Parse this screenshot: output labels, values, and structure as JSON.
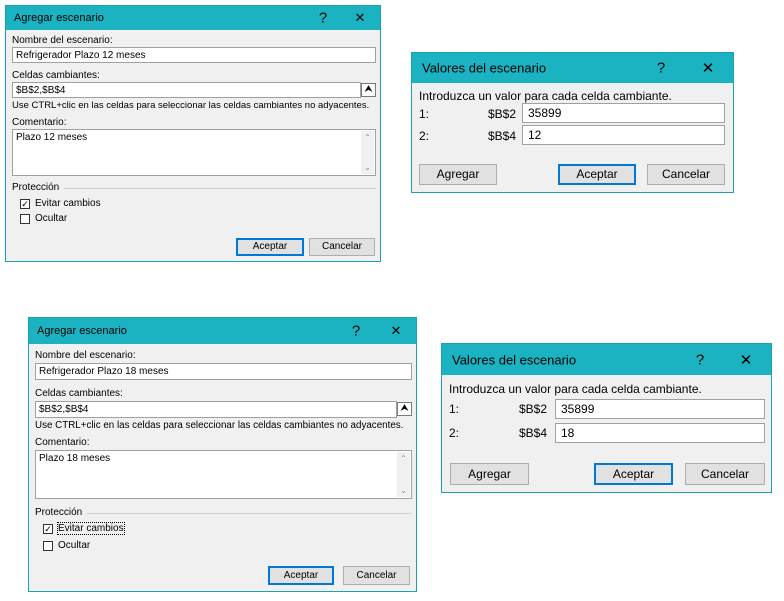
{
  "dialog1": {
    "title": "Agregar escenario",
    "help": "?",
    "close": "✕",
    "name_label": "Nombre del escenario:",
    "name_value": "Refrigerador Plazo 12 meses",
    "cells_label": "Celdas cambiantes:",
    "cells_value": "$B$2,$B$4",
    "hint": "Use CTRL+clic en las celdas para seleccionar las celdas cambiantes no adyacentes.",
    "comment_label": "Comentario:",
    "comment_value": "Plazo 12 meses",
    "protection_label": "Protección",
    "prevent_changes": "Evitar cambios",
    "prevent_checked": true,
    "hide": "Ocultar",
    "hide_checked": false,
    "ok": "Aceptar",
    "cancel": "Cancelar"
  },
  "values1": {
    "title": "Valores del escenario",
    "help": "?",
    "close": "✕",
    "prompt": "Introduzca un valor para cada celda cambiante.",
    "rows": [
      {
        "index": "1:",
        "ref": "$B$2",
        "value": "35899"
      },
      {
        "index": "2:",
        "ref": "$B$4",
        "value": "12"
      }
    ],
    "add": "Agregar",
    "ok": "Aceptar",
    "cancel": "Cancelar"
  },
  "dialog2": {
    "title": "Agregar escenario",
    "help": "?",
    "close": "✕",
    "name_label": "Nombre del escenario:",
    "name_value": "Refrigerador Plazo 18 meses",
    "cells_label": "Celdas cambiantes:",
    "cells_value": "$B$2,$B$4",
    "hint": "Use CTRL+clic en las celdas para seleccionar las celdas cambiantes no adyacentes.",
    "comment_label": "Comentario:",
    "comment_value": "Plazo 18 meses",
    "protection_label": "Protección",
    "prevent_changes": "Evitar cambios",
    "prevent_checked": true,
    "hide": "Ocultar",
    "hide_checked": false,
    "ok": "Aceptar",
    "cancel": "Cancelar"
  },
  "values2": {
    "title": "Valores del escenario",
    "help": "?",
    "close": "✕",
    "prompt": "Introduzca un valor para cada celda cambiante.",
    "rows": [
      {
        "index": "1:",
        "ref": "$B$2",
        "value": "35899"
      },
      {
        "index": "2:",
        "ref": "$B$4",
        "value": "18"
      }
    ],
    "add": "Agregar",
    "ok": "Aceptar",
    "cancel": "Cancelar"
  },
  "colors": {
    "titlebar": "#1bb3c2",
    "dialog_bg": "#f0f0f0",
    "default_button_border": "#0078d7"
  }
}
